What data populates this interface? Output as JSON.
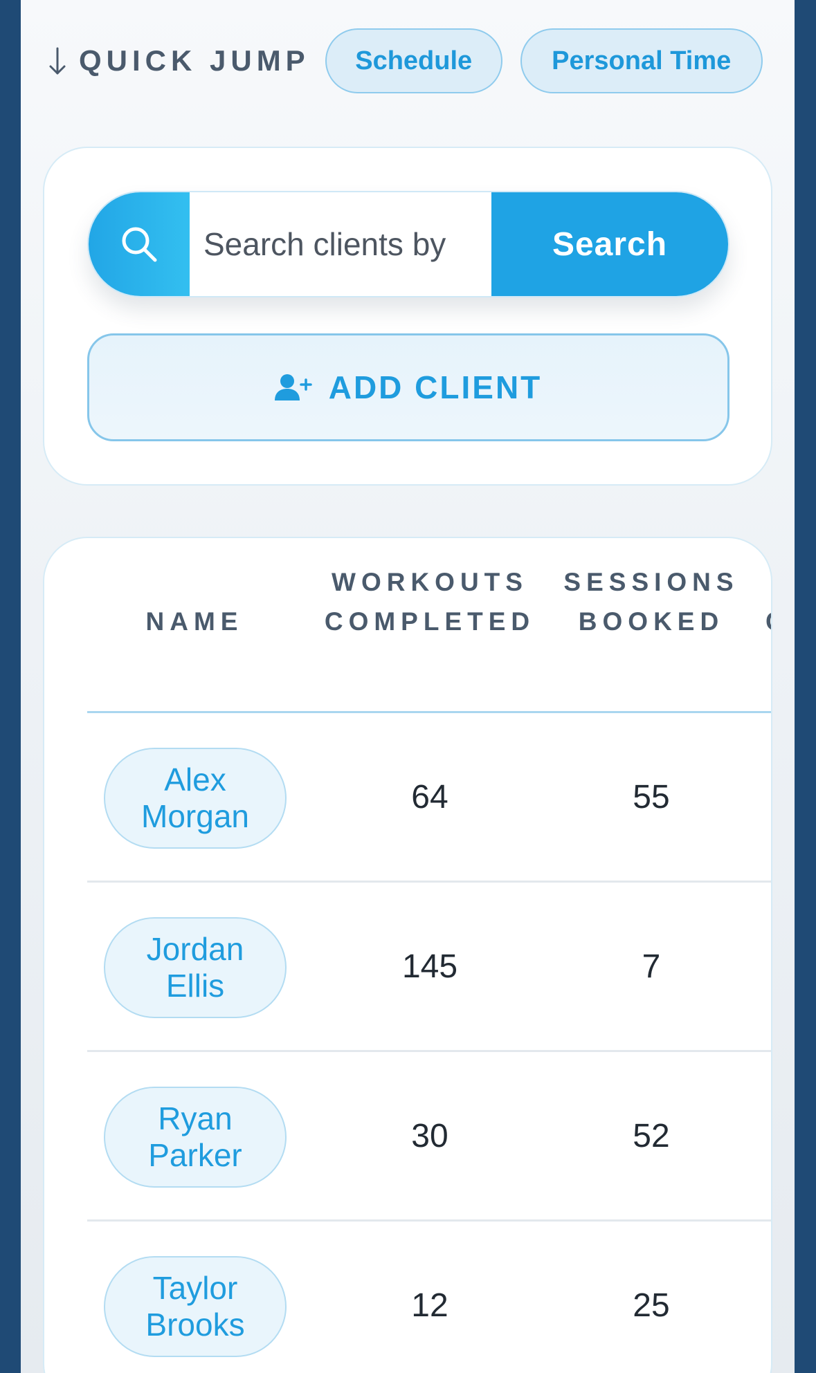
{
  "quick_jump": {
    "label": "QUICK JUMP",
    "chips": [
      {
        "label": "Schedule"
      },
      {
        "label": "Personal Time"
      }
    ]
  },
  "search": {
    "placeholder": "Search clients by",
    "button_label": "Search"
  },
  "add_client": {
    "label": "ADD CLIENT"
  },
  "table": {
    "headers": {
      "name": "NAME",
      "workouts_line1": "WORKOUTS",
      "workouts_line2": "COMPLETED",
      "sessions_line1": "SESSIONS",
      "sessions_line2": "BOOKED",
      "extra": "C"
    },
    "rows": [
      {
        "name_first": "Alex",
        "name_last": "Morgan",
        "workouts": "64",
        "sessions": "55"
      },
      {
        "name_first": "Jordan",
        "name_last": "Ellis",
        "workouts": "145",
        "sessions": "7"
      },
      {
        "name_first": "Ryan",
        "name_last": "Parker",
        "workouts": "30",
        "sessions": "52"
      },
      {
        "name_first": "Taylor",
        "name_last": "Brooks",
        "workouts": "12",
        "sessions": "25"
      }
    ]
  },
  "icons": {
    "quick_jump": "arrow-down-icon",
    "search": "search-icon",
    "add_client": "user-plus-icon"
  },
  "colors": {
    "accent": "#1fa3e4",
    "chip_bg": "#dcedf8",
    "frame_bg": "#1f4a75"
  }
}
